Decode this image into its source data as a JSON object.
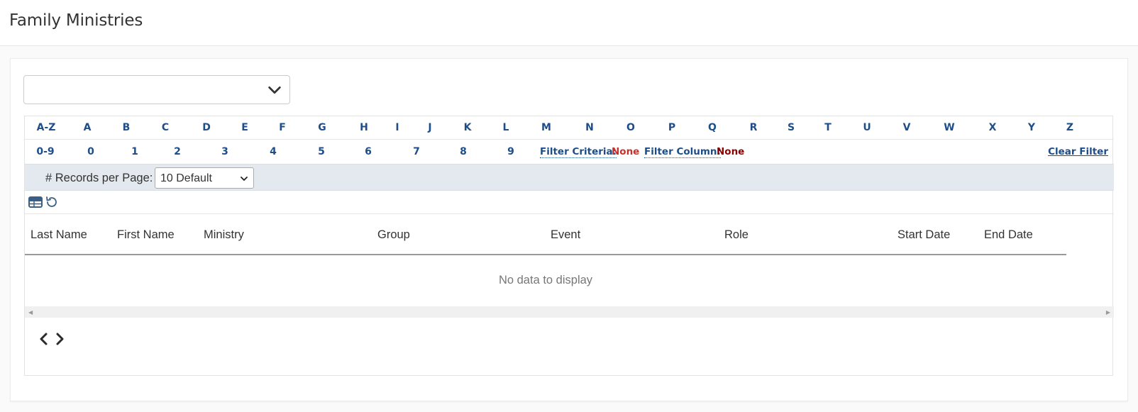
{
  "page": {
    "title": "Family Ministries"
  },
  "ministry_select": {
    "value": ""
  },
  "alpha_row_1": [
    "A-Z",
    "A",
    "B",
    "C",
    "D",
    "E",
    "F",
    "G",
    "H",
    "I",
    "J",
    "K",
    "L",
    "M",
    "N",
    "O",
    "P",
    "Q",
    "R",
    "S",
    "T",
    "U",
    "V",
    "W",
    "X",
    "Y",
    "Z"
  ],
  "alpha_row_2": [
    "0-9",
    "0",
    "1",
    "2",
    "3",
    "4",
    "5",
    "6",
    "7",
    "8",
    "9"
  ],
  "filter": {
    "criteria_label": "Filter Criteria:",
    "criteria_value": "None",
    "column_label": "Filter Column:",
    "column_value": "None",
    "clear_label": "Clear Filter"
  },
  "records": {
    "label": "# Records per Page:",
    "selected": "10 Default"
  },
  "toolbar": {
    "icons": [
      "table-layout-icon",
      "reset-icon"
    ]
  },
  "table": {
    "columns": [
      "Last Name",
      "First Name",
      "Ministry",
      "Group",
      "Event",
      "Role",
      "Start Date",
      "End Date"
    ],
    "empty_message": "No data to display"
  },
  "colors": {
    "link": "#1d4e89",
    "filter_value": "#c9302c",
    "filter_value_dark": "#8b0000",
    "records_bar": "#e3e9ef"
  }
}
